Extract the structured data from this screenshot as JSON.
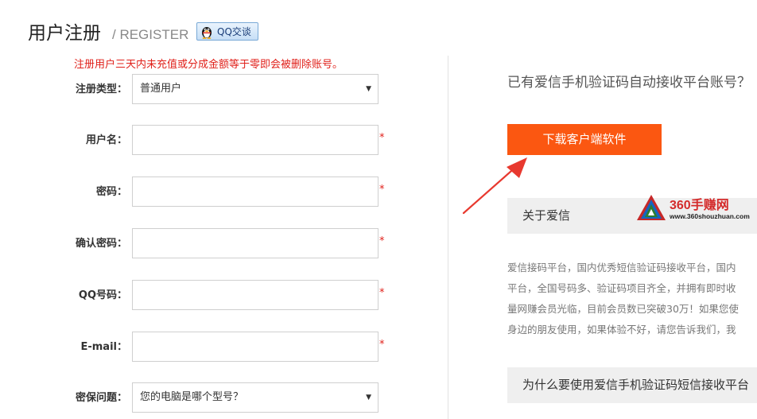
{
  "header": {
    "title": "用户注册",
    "subtitle": "/ REGISTER",
    "qq_button": "QQ交谈"
  },
  "notice": "注册用户三天内未充值或分成金额等于零即会被删除账号。",
  "form": {
    "fields": [
      {
        "label": "注册类型：",
        "value": "普通用户",
        "type": "select"
      },
      {
        "label": "用户名：",
        "value": "",
        "type": "text",
        "required": "*"
      },
      {
        "label": "密码：",
        "value": "",
        "type": "password",
        "required": "*"
      },
      {
        "label": "确认密码：",
        "value": "",
        "type": "password",
        "required": "*"
      },
      {
        "label": "QQ号码：",
        "value": "",
        "type": "text",
        "required": "*"
      },
      {
        "label": "E-mail：",
        "value": "",
        "type": "text",
        "required": "*"
      },
      {
        "label": "密保问题：",
        "value": "您的电脑是哪个型号？",
        "type": "select"
      }
    ],
    "select_arrow": "▼"
  },
  "right": {
    "login_prompt": "已有爱信手机验证码自动接收平台账号？",
    "download_button": "下载客户端软件",
    "about_title": "关于爱信",
    "about_lines": [
      "爱信接码平台，国内优秀短信验证码接收平台，国内",
      "平台，全国号码多、验证码项目齐全，并拥有即时收",
      "量网赚会员光临，目前会员数已突破30万！如果您使",
      "身边的朋友使用，如果体验不好，请您告诉我们，我"
    ],
    "why_title": "为什么要使用爱信手机验证码短信接收平台"
  },
  "watermark": {
    "title": "360手赚网",
    "url": "www.360shouzhuan.com"
  },
  "colors": {
    "accent": "#fb5711",
    "required": "#e0201a",
    "notice": "#e0201a",
    "section_bg": "#efefef"
  }
}
